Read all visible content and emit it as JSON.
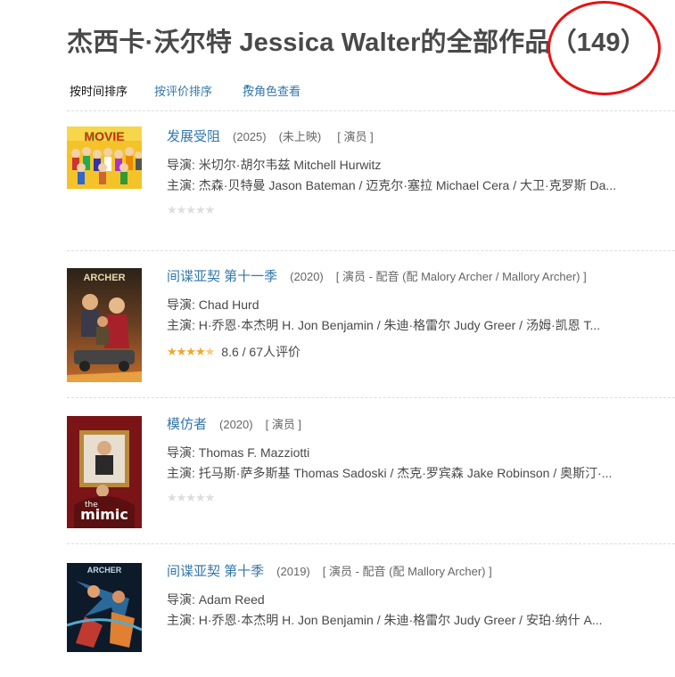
{
  "header": {
    "title": "杰西卡·沃尔特 Jessica Walter的全部作品",
    "count": "（149）"
  },
  "sort": {
    "by_time": "按时间排序",
    "by_rating": "按评价排序",
    "by_role": "按角色查看",
    "caret": "▾"
  },
  "labels": {
    "director": "导演: ",
    "cast": "主演: "
  },
  "items": [
    {
      "title": "发展受阻",
      "year": "(2025)",
      "status": "(未上映)",
      "role": "[ 演员 ]",
      "director": "米切尔·胡尔韦兹 Mitchell Hurwitz",
      "cast": "杰森·贝特曼 Jason Bateman / 迈克尔·塞拉 Michael Cera / 大卫·克罗斯 Da...",
      "stars": "★★★★★",
      "rating_value": "",
      "rating_text": ""
    },
    {
      "title": "间谍亚契 第十一季",
      "year": "(2020)",
      "status": "",
      "role": "[ 演员 - 配音 (配 Malory Archer / Mallory Archer) ]",
      "director": "Chad Hurd",
      "cast": "H·乔恩·本杰明 H. Jon Benjamin / 朱迪·格雷尔 Judy Greer / 汤姆·凯恩 T...",
      "stars_on": "★★★★",
      "stars_half": "★",
      "stars_off": "",
      "rating_value": 8.6,
      "rating_text": "8.6 / 67人评价"
    },
    {
      "title": "模仿者",
      "year": "(2020)",
      "status": "",
      "role": "[ 演员 ]",
      "director": "Thomas F. Mazziotti",
      "cast": "托马斯·萨多斯基 Thomas Sadoski / 杰克·罗宾森 Jake Robinson / 奥斯汀·...",
      "stars": "★★★★★",
      "rating_value": "",
      "rating_text": ""
    },
    {
      "title": "间谍亚契 第十季",
      "year": "(2019)",
      "status": "",
      "role": "[ 演员 - 配音 (配 Mallory Archer) ]",
      "director": "Adam Reed",
      "cast": "H·乔恩·本杰明 H. Jon Benjamin / 朱迪·格雷尔 Judy Greer / 安珀·纳什 A...",
      "stars": "",
      "rating_value": "",
      "rating_text": ""
    }
  ],
  "posters": {
    "movie_logo_text": "MOVIE",
    "archer_logo_text": "ARCHER",
    "mimic_text_small": "the",
    "mimic_text": "mimic"
  },
  "colors": {
    "link": "#3377aa",
    "text": "#494949",
    "star_on": "#f5a623",
    "star_off": "#dddddd",
    "annotation_circle": "#e51414"
  }
}
